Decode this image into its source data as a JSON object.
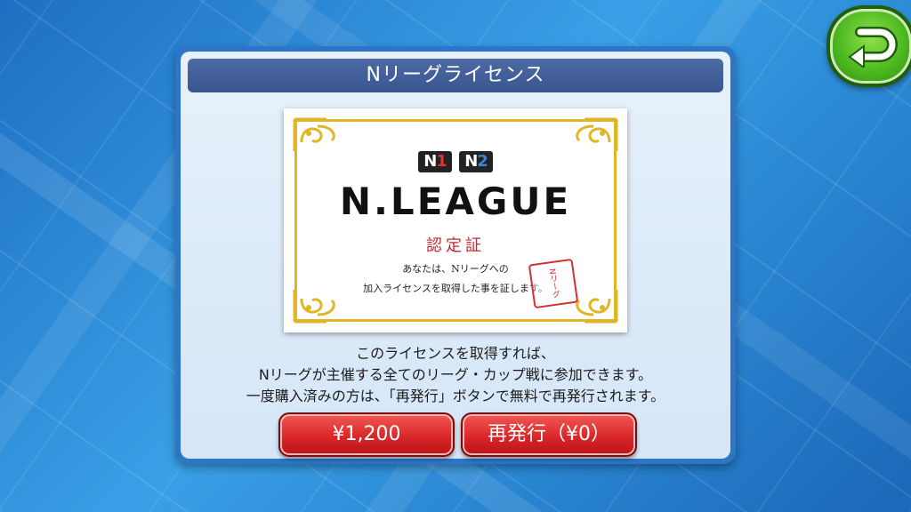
{
  "dialog": {
    "title": "Nリーグライセンス"
  },
  "certificate": {
    "logo_n1": {
      "letter": "N",
      "digit": "1"
    },
    "logo_n2": {
      "letter": "N",
      "digit": "2"
    },
    "title": "N.LEAGUE",
    "subtitle": "認定証",
    "body_line1": "あなたは、Nリーグへの",
    "body_line2": "加入ライセンスを取得した事を証します。",
    "seal_text": "Nリーグ"
  },
  "description": {
    "line1": "このライセンスを取得すれば、",
    "line2": "Nリーグが主催する全てのリーグ・カップ戦に参加できます。",
    "line3": "一度購入済みの方は、「再発行」ボタンで無料で再発行されます。"
  },
  "buttons": {
    "buy_label": "¥1,200",
    "reissue_label": "再発行（¥0）"
  },
  "icons": {
    "back": "back-arrow-icon"
  },
  "colors": {
    "accent_green": "#4cb81f",
    "button_red": "#d9272a",
    "title_bar": "#4d6aa4",
    "cert_gold": "#e2b623"
  }
}
